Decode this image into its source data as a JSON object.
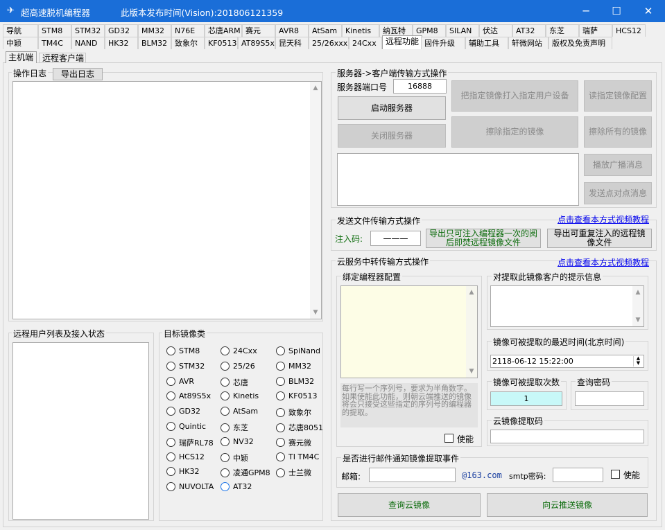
{
  "window": {
    "title": "超高速脱机编程器",
    "version": "此版本发布时间(Vision):201806121359",
    "minimize": "─",
    "maximize": "☐",
    "close": "✕"
  },
  "tabs_row1": [
    "导航",
    "STM8",
    "STM32",
    "GD32",
    "MM32",
    "N76E",
    "芯唐ARM",
    "赛元",
    "AVR8",
    "AtSam",
    "Kinetis",
    "纳瓦特",
    "GPM8",
    "SILAN",
    "伏达",
    "AT32",
    "东芝",
    "瑞萨",
    "HCS12"
  ],
  "tabs_row2": [
    "中颖",
    "TM4C",
    "NAND",
    "HK32",
    "BLM32",
    "致象尔",
    "KF0513",
    "AT89S5x",
    "昆天科",
    "25/26xxx",
    "24Cxx",
    "远程功能",
    "固件升级",
    "辅助工具",
    "轩微网站",
    "版权及免责声明"
  ],
  "subtabs": [
    "主机端",
    "远程客户端"
  ],
  "log": {
    "label": "操作日志",
    "export_btn": "导出日志"
  },
  "remote_users": {
    "label": "远程用户列表及接入状态"
  },
  "target": {
    "label": "目标镜像类",
    "col1": [
      "STM8",
      "STM32",
      "AVR",
      "At89S5x",
      "GD32",
      "Quintic",
      "瑞萨RL78",
      "HCS12",
      "HK32",
      "NUVOLTA"
    ],
    "col2": [
      "24Cxx",
      "25/26",
      "芯唐",
      "Kinetis",
      "AtSam",
      "东芝",
      "NV32",
      "中颖",
      "凌通GPM8",
      "AT32"
    ],
    "col3": [
      "SpiNand",
      "MM32",
      "BLM32",
      "KF0513",
      "致象尔",
      "芯唐8051",
      "赛元微",
      "TI TM4C",
      "士兰微"
    ]
  },
  "server": {
    "label": "服务器->客户端传输方式操作",
    "port_label": "服务器端口号",
    "port_value": "16888",
    "start_btn": "启动服务器",
    "stop_btn": "关闭服务器",
    "push_btn": "把指定镜像打入指定用户设备",
    "read_btn": "读指定镜像配置",
    "erase_btn": "擦除指定的镜像",
    "erase_all_btn": "擦除所有的镜像",
    "broadcast_btn": "播放广播消息",
    "p2p_btn": "发送点对点消息"
  },
  "sendfile": {
    "label": "发送文件传输方式操作",
    "video_link": "点击查看本方式视频教程",
    "code_label": "注入码:",
    "code_value": "———",
    "once_btn": "导出只可注入编程器一次的阅后即焚远程镜像文件",
    "repeat_btn": "导出可重复注入的远程镜像文件"
  },
  "cloud": {
    "label": "云服务中转传输方式操作",
    "video_link": "点击查看本方式视频教程",
    "bind_label": "绑定编程器配置",
    "hint": "每行写一个序列号，要求为半角数字。如果使能此功能，则朝云端推送的镜像将会只接受这些指定的序列号的编程器的提取。",
    "enable_label": "使能",
    "tip_label": "对提取此镜像客户的提示信息",
    "deadline_label": "镜像可被提取的最迟时间(北京时间)",
    "deadline_value": "2118-06-12 15:22:00",
    "count_label": "镜像可被提取次数",
    "count_value": "1",
    "pwd_label": "查询密码",
    "code_label": "云镜像提取码",
    "mail_label": "是否进行邮件通知镜像提取事件",
    "email_label": "邮箱:",
    "email_domain": "@163.com",
    "smtp_label": "smtp密码:",
    "mail_enable": "使能",
    "query_btn": "查询云镜像",
    "push_btn": "向云推送镜像"
  }
}
